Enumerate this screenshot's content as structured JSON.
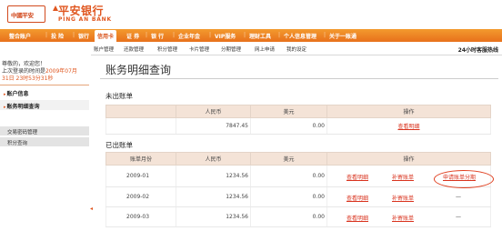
{
  "header": {
    "logo_box_text": "中國平安",
    "bank_name_cn": "平安银行",
    "bank_name_en": "PING AN BANK",
    "colors": {
      "brand": "#e0561f",
      "nav_top": "#f39a2e",
      "nav_bottom": "#e8711c",
      "header_row": "#f4e3d7"
    }
  },
  "main_nav": {
    "items": [
      {
        "label": "整合账户"
      },
      {
        "label": "投 险"
      },
      {
        "label": "银行"
      },
      {
        "label": "信用卡",
        "active": true
      },
      {
        "label": "证 券"
      },
      {
        "label": "银 行"
      },
      {
        "label": "企业年金"
      },
      {
        "label": "VIP服务"
      },
      {
        "label": "理财工具"
      },
      {
        "label": "个人信息管理"
      },
      {
        "label": "关于一账通"
      }
    ]
  },
  "service_hotline": "24小时客服热线",
  "sub_nav": {
    "items": [
      {
        "label": "账户管理"
      },
      {
        "label": "还款管理"
      },
      {
        "label": "积分管理"
      },
      {
        "label": "卡片管理"
      },
      {
        "label": "分期管理"
      },
      {
        "label": "网上申请"
      },
      {
        "label": "我的设定"
      }
    ]
  },
  "sidebar": {
    "welcome_line1_prefix": "尊敬的",
    "welcome_line1_suffix": "，欢迎您！",
    "welcome_line2_prefix": "上次登录的时间是",
    "welcome_line2_date": "2009年07月",
    "welcome_line3": "31日 23时53分31秒",
    "menu": [
      {
        "label": "账户信息"
      },
      {
        "label": "账务明细查询",
        "selected": true
      }
    ],
    "submenu": [
      {
        "label": "交易密码管理"
      },
      {
        "label": "积分查询"
      }
    ]
  },
  "content": {
    "page_title": "账务明细查询",
    "unbilled": {
      "section_label": "未出账单",
      "headers": [
        "人民币",
        "美元",
        "操作"
      ],
      "row": {
        "rmb": "7847.45",
        "usd": "0.00",
        "action": "查看明细"
      }
    },
    "billed": {
      "section_label": "已出账单",
      "headers": [
        "账单月份",
        "人民币",
        "美元",
        "操作"
      ],
      "rows": [
        {
          "month": "2009-01",
          "rmb": "1234.56",
          "usd": "0.00",
          "view": "查看明细",
          "resend": "补寄账单",
          "install": "申请账单分期"
        },
        {
          "month": "2009-02",
          "rmb": "1234.56",
          "usd": "0.00",
          "view": "查看明细",
          "resend": "补寄账单",
          "install": "—"
        },
        {
          "month": "2009-03",
          "rmb": "1234.56",
          "usd": "0.00",
          "view": "查看明细",
          "resend": "补寄账单",
          "install": "—"
        }
      ]
    }
  }
}
